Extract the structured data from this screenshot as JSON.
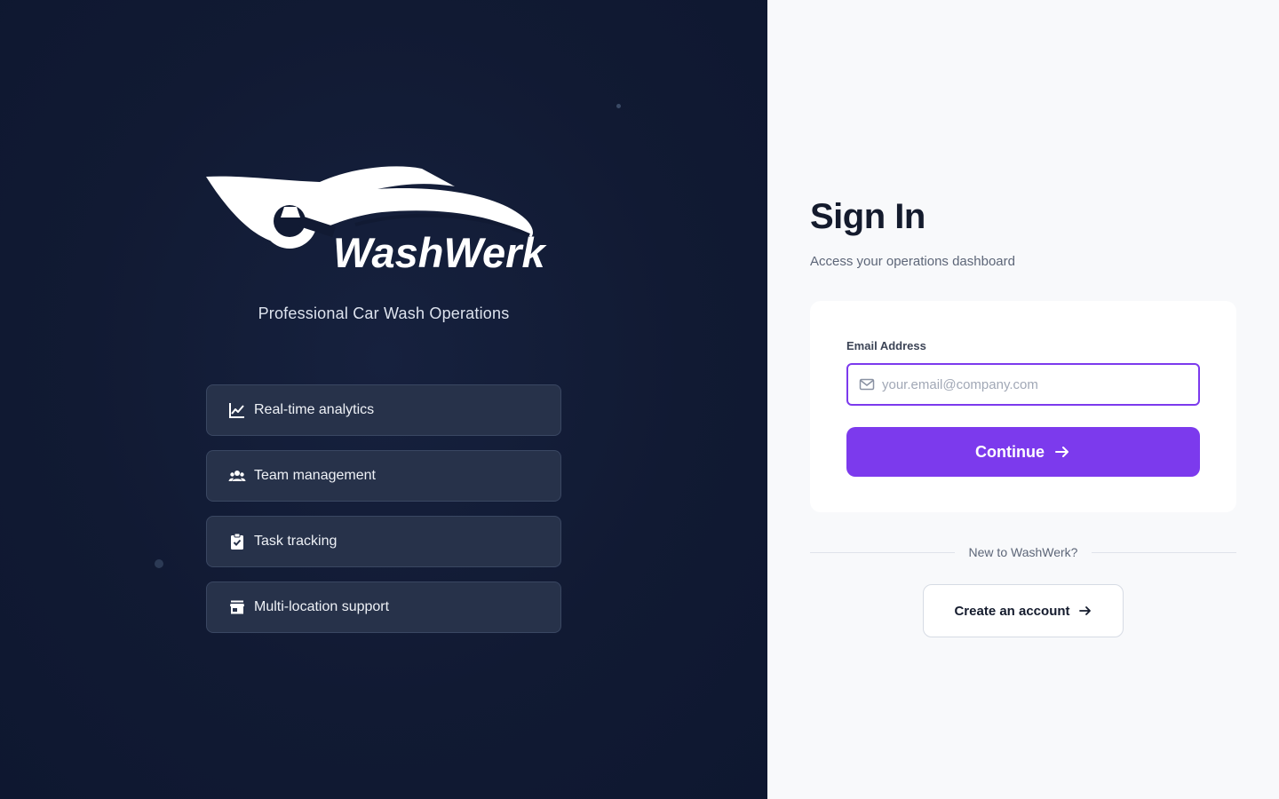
{
  "brand": {
    "logo_text": "WashWerk",
    "tagline": "Professional Car Wash Operations"
  },
  "features": [
    {
      "icon": "line-chart-icon",
      "label": "Real-time analytics"
    },
    {
      "icon": "users-icon",
      "label": "Team management"
    },
    {
      "icon": "clipboard-check-icon",
      "label": "Task tracking"
    },
    {
      "icon": "store-icon",
      "label": "Multi-location support"
    }
  ],
  "signin": {
    "title": "Sign In",
    "subtitle": "Access your operations dashboard",
    "email_label": "Email Address",
    "email_placeholder": "your.email@company.com",
    "email_value": "",
    "continue_label": "Continue",
    "divider_text": "New to WashWerk?",
    "create_label": "Create an account"
  },
  "colors": {
    "brand_panel_bg": "#111a33",
    "accent": "#7c3aed",
    "feature_bg": "#27324a",
    "signin_bg": "#f8f9fb",
    "title_text": "#141b2d"
  }
}
